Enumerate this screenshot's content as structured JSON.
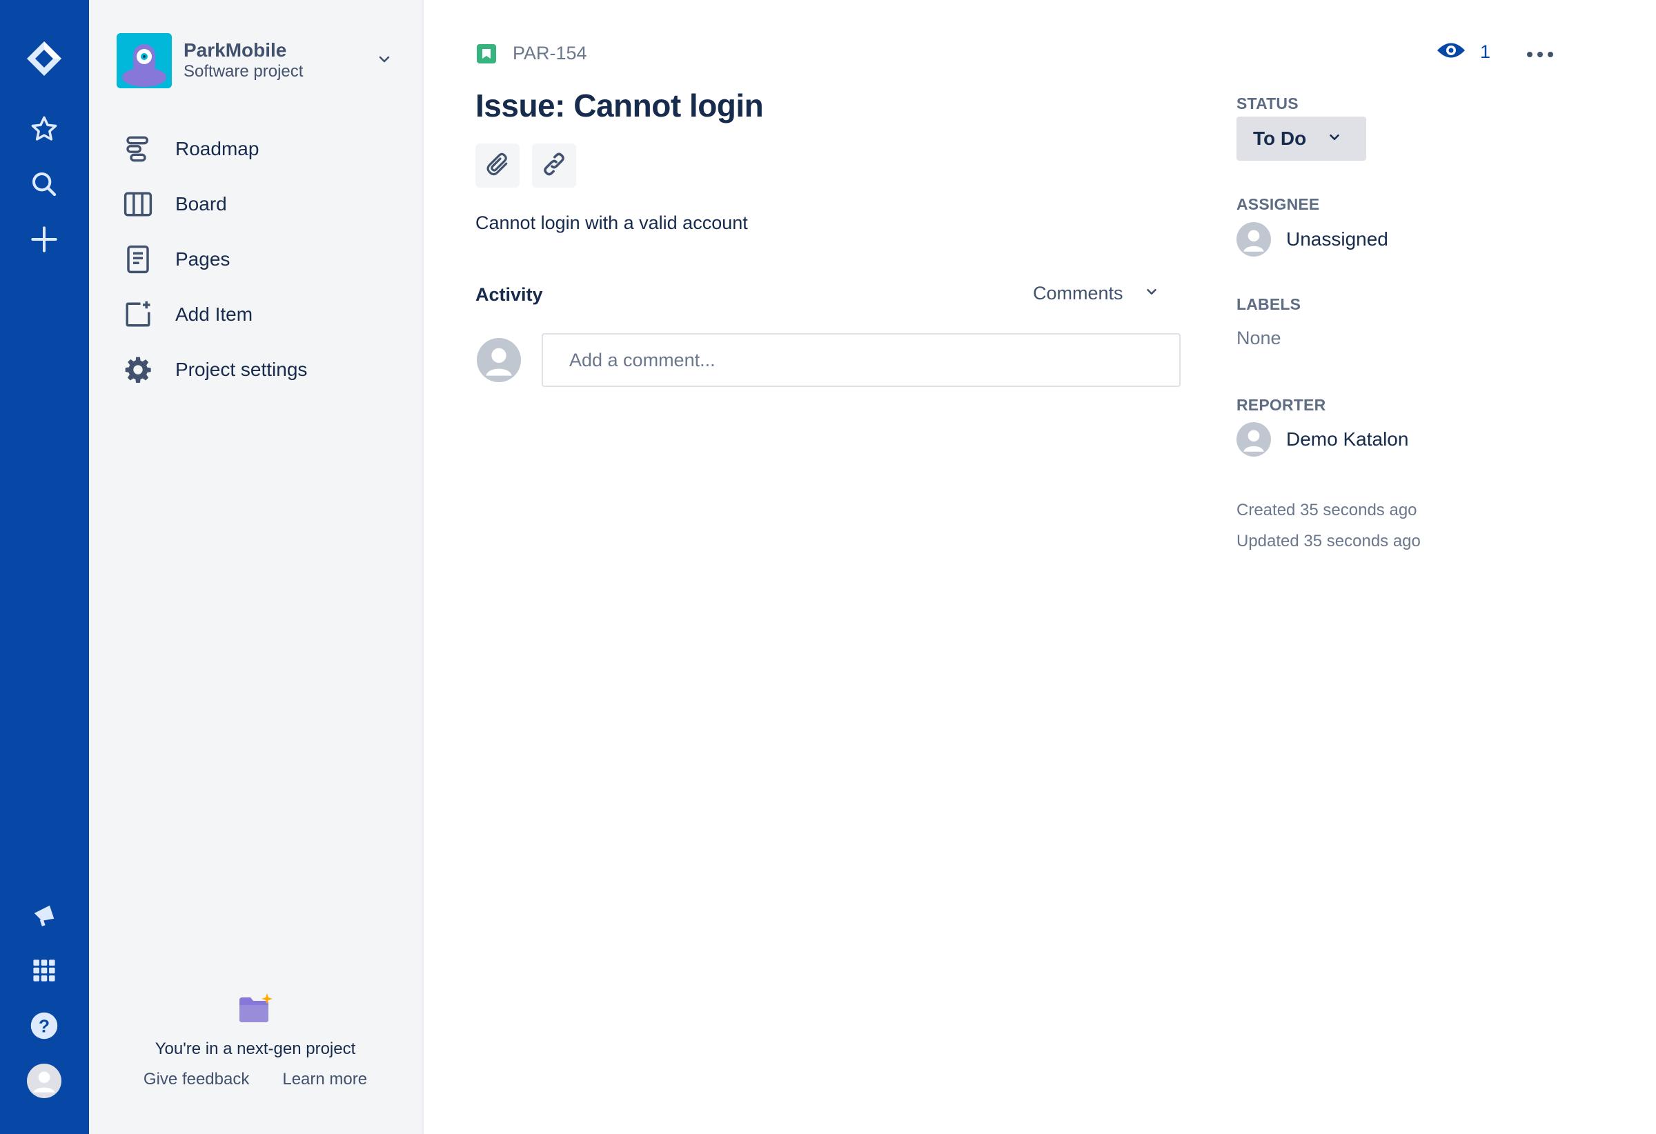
{
  "global_nav": {
    "icons": [
      "jira-logo-icon",
      "star-icon",
      "search-icon",
      "plus-icon",
      "megaphone-icon",
      "app-switcher-icon",
      "help-icon",
      "profile-avatar-icon"
    ]
  },
  "project": {
    "name": "ParkMobile",
    "type": "Software project"
  },
  "sidebar": {
    "items": [
      {
        "label": "Roadmap",
        "icon": "roadmap-icon"
      },
      {
        "label": "Board",
        "icon": "board-icon"
      },
      {
        "label": "Pages",
        "icon": "pages-icon"
      },
      {
        "label": "Add Item",
        "icon": "add-item-icon"
      },
      {
        "label": "Project settings",
        "icon": "gear-icon"
      }
    ],
    "footer": {
      "text": "You're in a next-gen project",
      "give_feedback": "Give feedback",
      "learn_more": "Learn more"
    }
  },
  "issue": {
    "key": "PAR-154",
    "title": "Issue: Cannot login",
    "description": "Cannot login with a valid account",
    "watchers": "1"
  },
  "activity": {
    "heading": "Activity",
    "filter": "Comments",
    "comment_placeholder": "Add a comment..."
  },
  "details": {
    "status_label": "STATUS",
    "status_value": "To Do",
    "assignee_label": "ASSIGNEE",
    "assignee_value": "Unassigned",
    "labels_label": "LABELS",
    "labels_value": "None",
    "reporter_label": "REPORTER",
    "reporter_value": "Demo Katalon",
    "created": "Created 35 seconds ago",
    "updated": "Updated 35 seconds ago"
  },
  "colors": {
    "nav_blue": "#0747A6",
    "sidebar_bg": "#F4F5F7",
    "issue_type_green": "#36B37E",
    "project_avatar": "#00B8D9"
  }
}
